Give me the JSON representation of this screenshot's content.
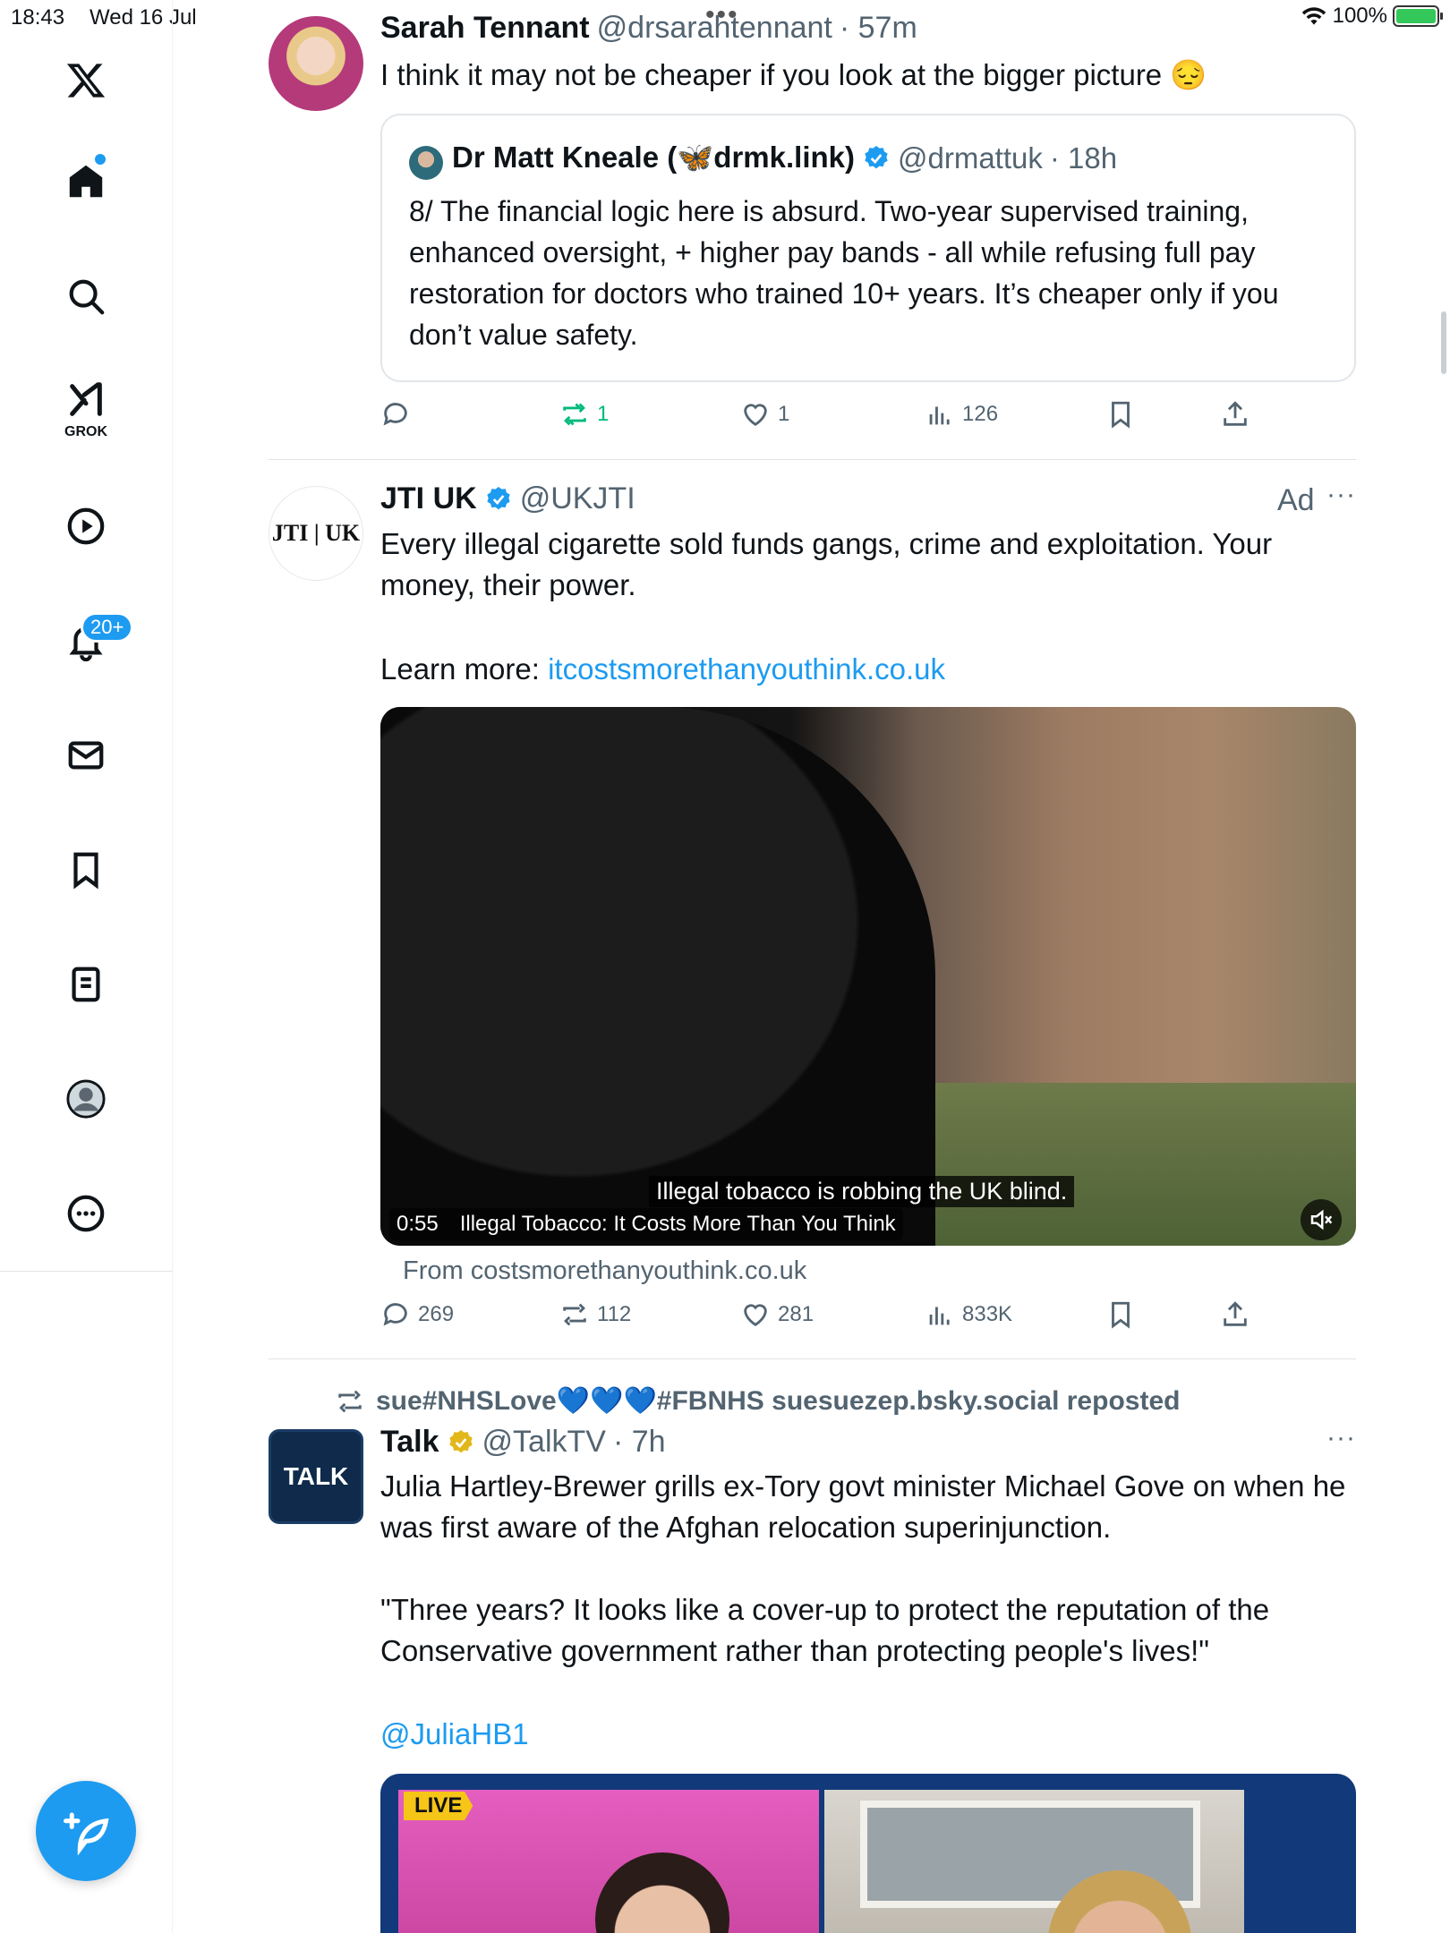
{
  "status_bar": {
    "time": "18:43",
    "date": "Wed 16 Jul",
    "battery": "100%",
    "dots": "•••"
  },
  "sidebar": {
    "items": [
      {
        "name": "x-logo",
        "label": ""
      },
      {
        "name": "home",
        "label": ""
      },
      {
        "name": "search",
        "label": ""
      },
      {
        "name": "grok",
        "label": "GROK"
      },
      {
        "name": "video",
        "label": ""
      },
      {
        "name": "notifications",
        "label": ""
      },
      {
        "name": "messages",
        "label": ""
      },
      {
        "name": "bookmarks",
        "label": ""
      },
      {
        "name": "lists",
        "label": ""
      },
      {
        "name": "profile",
        "label": ""
      },
      {
        "name": "more",
        "label": ""
      }
    ],
    "notif_badge": "20+",
    "accent": "#1d9bf0"
  },
  "tweets": [
    {
      "name": "Sarah Tennant",
      "handle": "@drsarahtennant",
      "time": "· 57m",
      "text": "I think it may not be cheaper if you look at the bigger picture 😔",
      "quote": {
        "name": "Dr Matt Kneale (🦋drmk.link)",
        "handle": "@drmattuk",
        "time": "· 18h",
        "text": "8/ The financial logic here is absurd. Two-year supervised training, enhanced oversight, + higher pay bands - all while refusing full pay restoration for doctors who trained 10+ years. It’s cheaper only if you don’t value safety."
      },
      "actions": {
        "replies": "",
        "reposts": "1",
        "likes": "1",
        "views": "126"
      }
    },
    {
      "name": "JTI UK",
      "handle": "@UKJTI",
      "ad_label": "Ad",
      "avatar_text": "JTI | UK",
      "text_1": "Every illegal cigarette sold funds gangs, crime and exploitation. Your money, their power.",
      "text_2_prefix": "Learn more: ",
      "text_2_link": "itcostsmorethanyouthink.co.uk",
      "video": {
        "caption": "Illegal tobacco is robbing the UK blind.",
        "duration": "0:55",
        "title": "Illegal Tobacco: It Costs More Than You Think"
      },
      "source": "From costsmorethanyouthink.co.uk",
      "actions": {
        "replies": "269",
        "reposts": "112",
        "likes": "281",
        "views": "833K"
      }
    },
    {
      "repost_label": "sue#NHSLove💙💙💙#FBNHS suesuezep.bsky.social reposted",
      "name": "Talk",
      "handle": "@TalkTV",
      "time": "· 7h",
      "avatar_text": "TALK",
      "text_1": "Julia Hartley-Brewer grills ex-Tory govt minister Michael Gove on when he was first aware of the Afghan relocation superinjunction.",
      "text_2": "\"Three years? It looks like a cover-up to protect the reputation of the Conservative government rather than protecting people's lives!\"",
      "mention": "@JuliaHB1",
      "live_label": "LIVE"
    }
  ]
}
